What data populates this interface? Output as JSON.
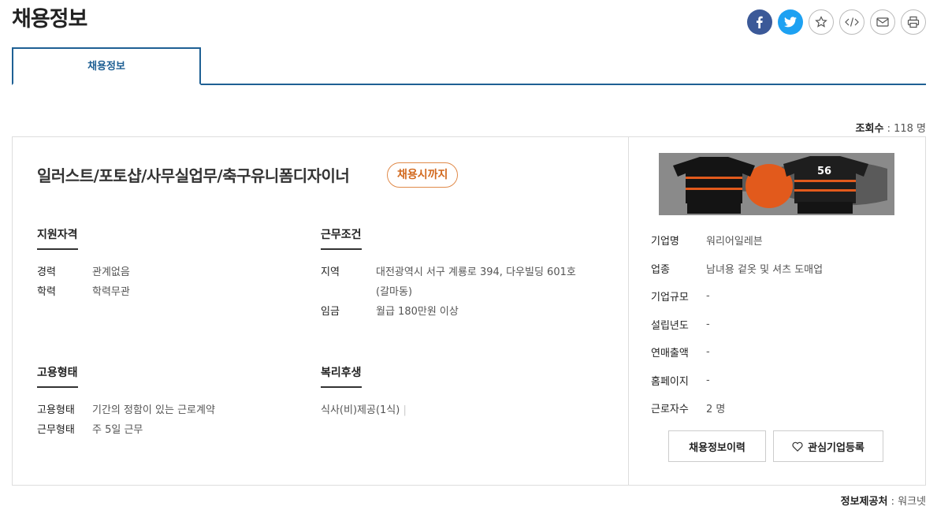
{
  "page": {
    "title": "채용정보"
  },
  "share": {
    "facebook": "facebook-icon",
    "twitter": "twitter-icon",
    "bookmark": "star-icon",
    "embed": "code-icon",
    "email": "mail-icon",
    "print": "print-icon"
  },
  "tabs": [
    {
      "label": "채용정보"
    }
  ],
  "views": {
    "label": "조회수",
    "value": "118 명"
  },
  "job": {
    "title": "일러스트/포토샵/사무실업무/축구유니폼디자이너",
    "deadline": "채용시까지"
  },
  "qualification": {
    "title": "지원자격",
    "rows": [
      {
        "k": "경력",
        "v": "관계없음"
      },
      {
        "k": "학력",
        "v": "학력무관"
      }
    ]
  },
  "conditions": {
    "title": "근무조건",
    "rows": [
      {
        "k": "지역",
        "v": "대전광역시 서구 계룡로 394, 다우빌딩 601호",
        "v2": "(갈마동)"
      },
      {
        "k": "임금",
        "v": "월급 180만원 이상"
      }
    ]
  },
  "employment": {
    "title": "고용형태",
    "rows": [
      {
        "k": "고용형태",
        "v": "기간의 정함이 있는 근로계약"
      },
      {
        "k": "근무형태",
        "v": "주 5일 근무"
      }
    ]
  },
  "welfare": {
    "title": "복리후생",
    "value": "식사(비)제공(1식)"
  },
  "company": {
    "jersey_number": "56",
    "rows": [
      {
        "k": "기업명",
        "v": "워리어일레븐"
      },
      {
        "k": "업종",
        "v": "남녀용 겉옷 및 셔츠 도매업"
      },
      {
        "k": "기업규모",
        "v": "-"
      },
      {
        "k": "설립년도",
        "v": "-"
      },
      {
        "k": "연매출액",
        "v": "-"
      },
      {
        "k": "홈페이지",
        "v": "-"
      },
      {
        "k": "근로자수",
        "v": "2 명"
      }
    ],
    "history_button": "채용정보이력",
    "favorite_button": "관심기업등록"
  },
  "source": {
    "label": "정보제공처",
    "value": "워크넷"
  },
  "colors": {
    "accent": "#1f6094",
    "deadline": "#d2691e",
    "facebook": "#3b5998",
    "twitter": "#1da1f2"
  }
}
